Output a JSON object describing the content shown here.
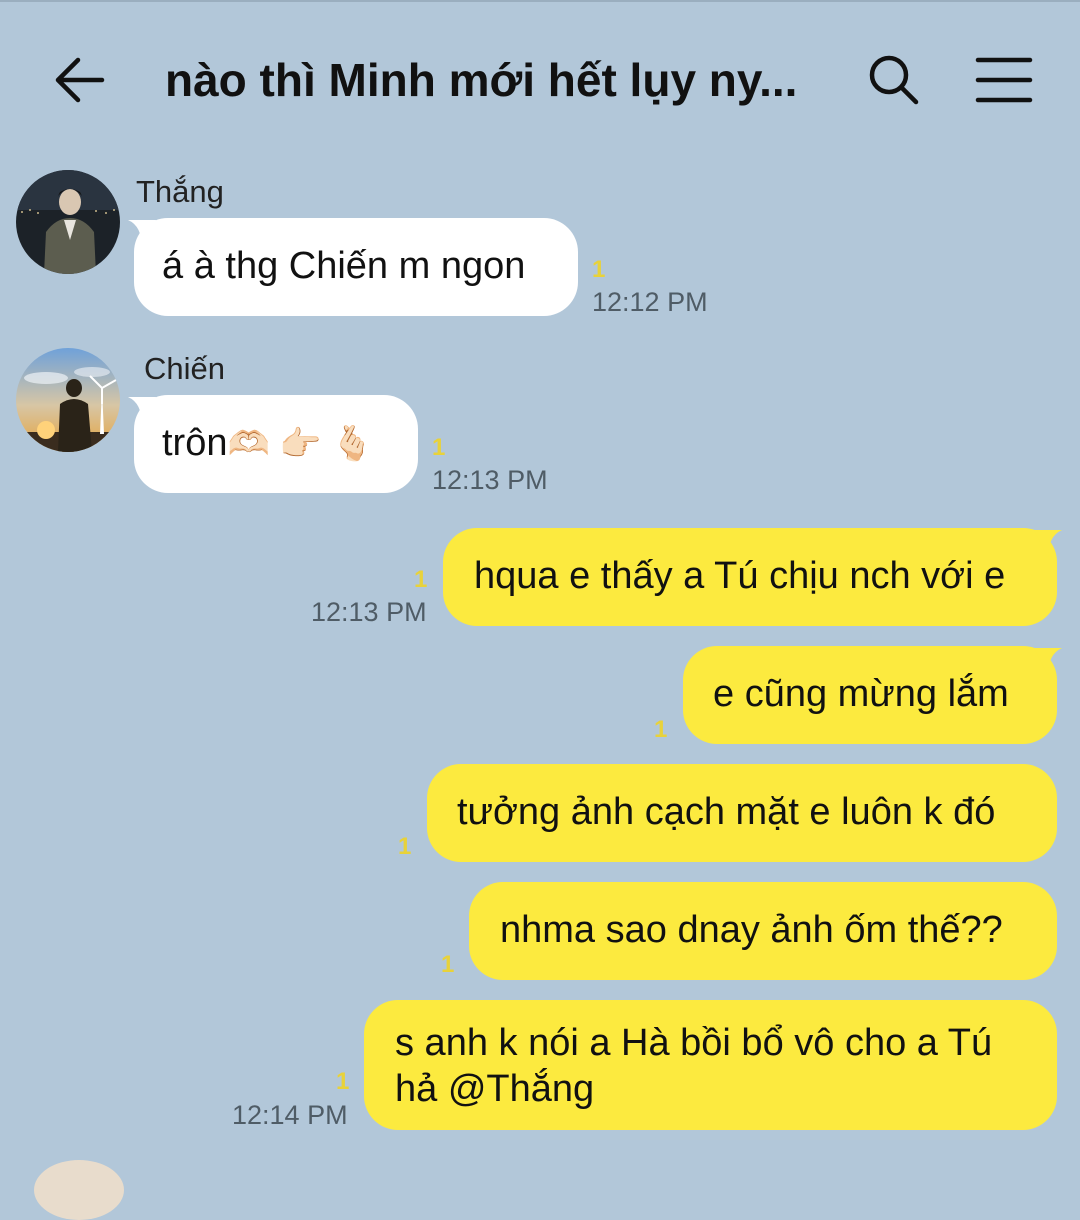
{
  "header": {
    "title": "nào thì Minh mới hết lụy ny...",
    "back_icon": "arrow-left-icon",
    "search_icon": "search-icon",
    "menu_icon": "hamburger-menu-icon"
  },
  "messages": [
    {
      "sender": "Thắng",
      "text": "á à thg Chiến m ngon",
      "unread": "1",
      "time": "12:12 PM"
    },
    {
      "sender": "Chiến",
      "text": "trôn",
      "emojis": "🫶🏻 👉🏻 🫰🏻",
      "unread": "1",
      "time": "12:13 PM"
    },
    {
      "text": "hqua e thấy a Tú chịu nch với e",
      "unread": "1",
      "time": "12:13 PM"
    },
    {
      "text": "e cũng mừng lắm",
      "unread": "1"
    },
    {
      "text": "tưởng ảnh cạch mặt e luôn k đó",
      "unread": "1"
    },
    {
      "text": "nhma sao dnay ảnh ốm thế??",
      "unread": "1"
    },
    {
      "text": "s anh k nói a Hà bồi bổ vô cho a Tú hả @Thắng",
      "unread": "1",
      "time": "12:14 PM"
    }
  ],
  "colors": {
    "background": "#b2c7d9",
    "incoming_bubble": "#ffffff",
    "outgoing_bubble": "#fcea3f",
    "unread_count": "#e8d23a"
  }
}
